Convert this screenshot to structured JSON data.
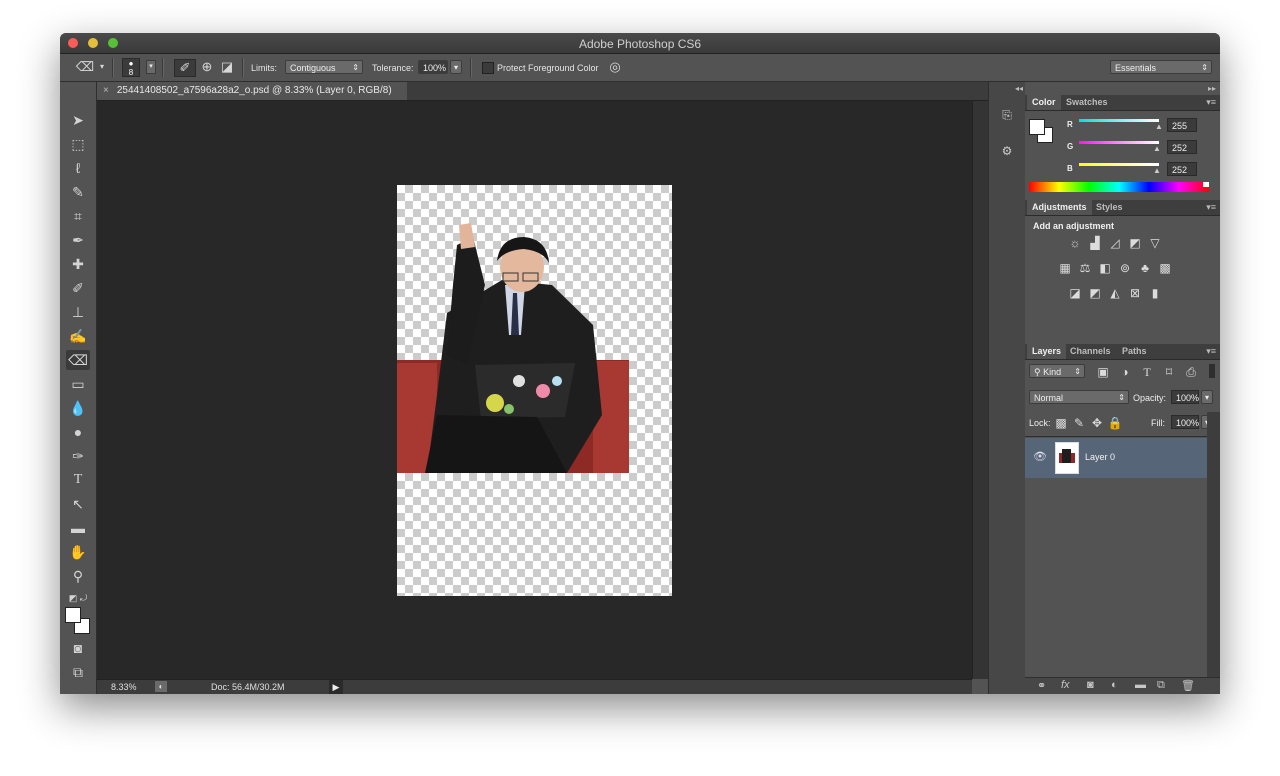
{
  "window": {
    "title": "Adobe Photoshop CS6"
  },
  "options_bar": {
    "brush_size": "8",
    "limits_label": "Limits:",
    "limits_value": "Contiguous",
    "tolerance_label": "Tolerance:",
    "tolerance_value": "100%",
    "protect_label": "Protect Foreground Color",
    "workspace": "Essentials"
  },
  "document": {
    "tab_title": "25441408502_a7596a28a2_o.psd @ 8.33% (Layer 0, RGB/8)",
    "close_glyph": "×"
  },
  "status": {
    "zoom": "8.33%",
    "doc_info": "Doc: 56.4M/30.2M"
  },
  "color_panel": {
    "tabs": [
      "Color",
      "Swatches"
    ],
    "channels": [
      {
        "label": "R",
        "value": "255",
        "color": "#e040e0"
      },
      {
        "label": "G",
        "value": "252",
        "color": "#e040e0"
      },
      {
        "label": "B",
        "value": "252",
        "color": "#e0e040"
      }
    ]
  },
  "adjustments_panel": {
    "tabs": [
      "Adjustments",
      "Styles"
    ],
    "heading": "Add an adjustment"
  },
  "layers_panel": {
    "tabs": [
      "Layers",
      "Channels",
      "Paths"
    ],
    "filter_kind": "Kind",
    "blend_mode": "Normal",
    "opacity_label": "Opacity:",
    "opacity_value": "100%",
    "lock_label": "Lock:",
    "fill_label": "Fill:",
    "fill_value": "100%",
    "layers": [
      {
        "name": "Layer 0",
        "visible": true
      }
    ]
  },
  "colors": {
    "titlebar": "#3e3e3e",
    "chrome": "#535353",
    "canvas_bg": "#282828",
    "selected_layer": "#566678"
  }
}
